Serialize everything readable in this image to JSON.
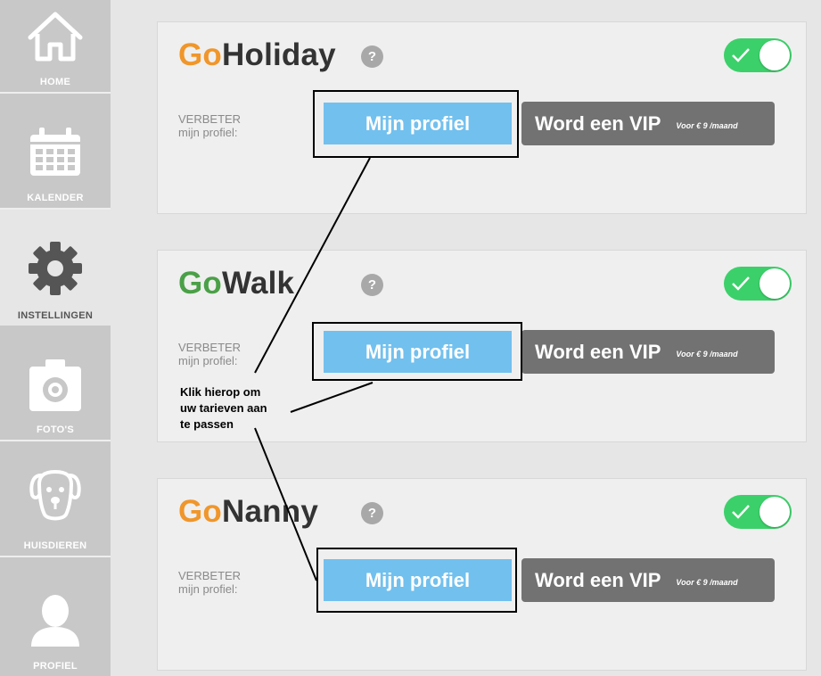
{
  "sidebar": {
    "items": [
      {
        "label": "HOME",
        "icon": "home-icon"
      },
      {
        "label": "KALENDER",
        "icon": "calendar-icon"
      },
      {
        "label": "INSTELLINGEN",
        "icon": "gear-icon",
        "active": true
      },
      {
        "label": "FOTO'S",
        "icon": "camera-icon"
      },
      {
        "label": "HUISDIEREN",
        "icon": "dog-icon"
      },
      {
        "label": "PROFIEL",
        "icon": "user-icon"
      }
    ]
  },
  "services": [
    {
      "brand_prefix": "Go",
      "brand_name": "Holiday",
      "prefix_color": "#f0962a",
      "help": "?",
      "toggle_on": true,
      "improve_line1": "VERBETER",
      "improve_line2": "mijn profiel:",
      "profile_button": "Mijn profiel",
      "vip_button": "Word een VIP",
      "vip_price": "Voor € 9 /maand"
    },
    {
      "brand_prefix": "Go",
      "brand_name": "Walk",
      "prefix_color": "#4aa047",
      "help": "?",
      "toggle_on": true,
      "improve_line1": "VERBETER",
      "improve_line2": "mijn profiel:",
      "profile_button": "Mijn profiel",
      "vip_button": "Word een VIP",
      "vip_price": "Voor € 9 /maand"
    },
    {
      "brand_prefix": "Go",
      "brand_name": "Nanny",
      "prefix_color": "#f0962a",
      "help": "?",
      "toggle_on": true,
      "improve_line1": "VERBETER",
      "improve_line2": "mijn profiel:",
      "profile_button": "Mijn profiel",
      "vip_button": "Word een VIP",
      "vip_price": "Voor € 9 /maand"
    }
  ],
  "annotation": {
    "line1": "Klik hierop om",
    "line2": "uw tarieven aan",
    "line3": "te passen"
  },
  "colors": {
    "accent_blue": "#72c0ee",
    "toggle_green": "#3cd06a",
    "vip_gray": "#727272"
  }
}
